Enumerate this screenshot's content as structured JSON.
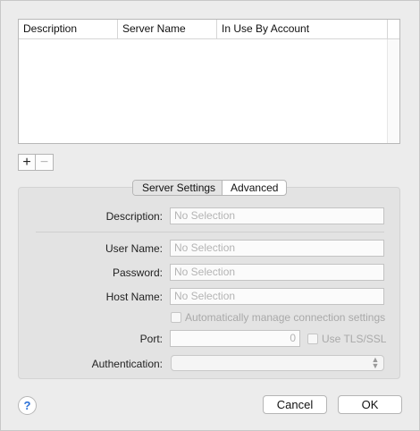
{
  "table": {
    "columns": [
      "Description",
      "Server Name",
      "In Use By Account"
    ]
  },
  "list_controls": {
    "add_label": "+",
    "remove_label": "−"
  },
  "tabs": [
    {
      "label": "Server Settings",
      "active": true
    },
    {
      "label": "Advanced",
      "active": false
    }
  ],
  "form": {
    "description": {
      "label": "Description:",
      "placeholder": "No Selection"
    },
    "user_name": {
      "label": "User Name:",
      "placeholder": "No Selection"
    },
    "password": {
      "label": "Password:",
      "placeholder": "No Selection"
    },
    "host_name": {
      "label": "Host Name:",
      "placeholder": "No Selection"
    },
    "auto_manage": {
      "label": "Automatically manage connection settings",
      "checked": false
    },
    "port": {
      "label": "Port:",
      "value": "0"
    },
    "use_tls": {
      "label": "Use TLS/SSL",
      "checked": false
    },
    "authentication": {
      "label": "Authentication:",
      "value": ""
    }
  },
  "buttons": {
    "help": "?",
    "cancel": "Cancel",
    "ok": "OK"
  }
}
